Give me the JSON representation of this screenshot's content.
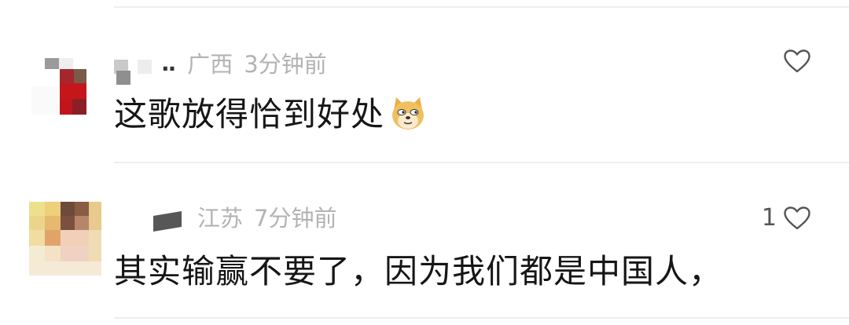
{
  "comments": [
    {
      "location": "广西",
      "time": "3分钟前",
      "text": "这歌放得恰到好处",
      "emoji_icon": "doge-emoji-icon",
      "like_count": ""
    },
    {
      "location": "江苏",
      "time": "7分钟前",
      "text": "其实输赢不要了，因为我们都是中国人，",
      "like_count": "1"
    }
  ],
  "icons": {
    "like": "heart-outline-icon"
  },
  "colors": {
    "text": "#161616",
    "meta": "#b3b3b3",
    "icon": "#555555",
    "divider": "#eeeeee"
  }
}
